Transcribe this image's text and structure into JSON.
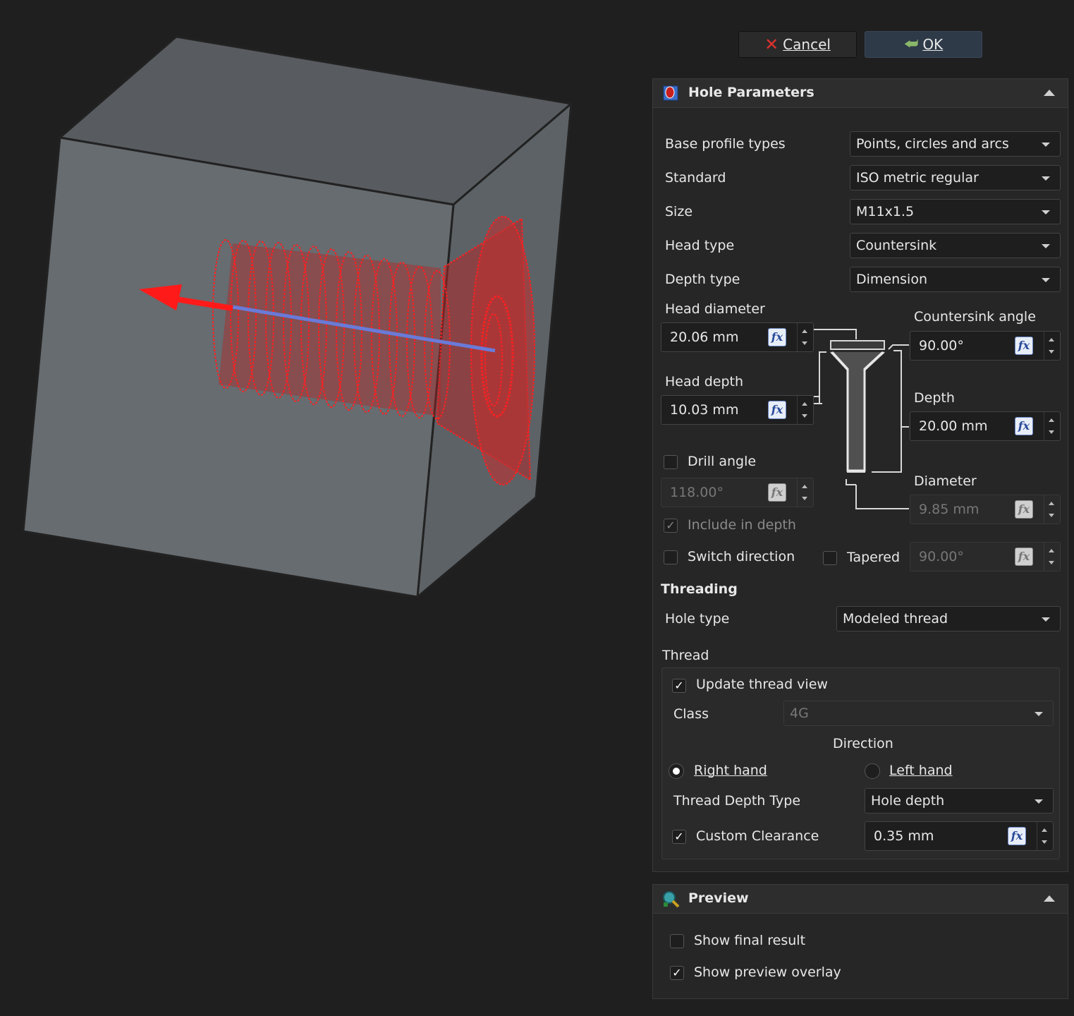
{
  "buttons": {
    "cancel": "Cancel",
    "ok": "OK"
  },
  "hole_panel": {
    "title": "Hole Parameters",
    "base_profile_types": {
      "label": "Base profile types",
      "value": "Points, circles and arcs"
    },
    "standard": {
      "label": "Standard",
      "value": "ISO metric regular"
    },
    "size": {
      "label": "Size",
      "value": "M11x1.5"
    },
    "head_type": {
      "label": "Head type",
      "value": "Countersink"
    },
    "depth_type": {
      "label": "Depth type",
      "value": "Dimension"
    },
    "head_diameter": {
      "label": "Head diameter",
      "value": "20.06 mm"
    },
    "countersink_angle": {
      "label": "Countersink angle",
      "value": "90.00°"
    },
    "head_depth": {
      "label": "Head depth",
      "value": "10.03 mm"
    },
    "depth": {
      "label": "Depth",
      "value": "20.00 mm"
    },
    "drill_angle": {
      "label": "Drill angle",
      "value": "118.00°",
      "checked": false
    },
    "diameter": {
      "label": "Diameter",
      "value": "9.85 mm"
    },
    "include_in_depth": {
      "label": "Include in depth",
      "checked": true
    },
    "switch_direction": {
      "label": "Switch direction",
      "checked": false
    },
    "tapered": {
      "label": "Tapered",
      "value": "90.00°",
      "checked": false
    },
    "threading": {
      "title": "Threading",
      "hole_type": {
        "label": "Hole type",
        "value": "Modeled thread"
      },
      "thread_group": "Thread",
      "update_thread_view": {
        "label": "Update thread view",
        "checked": true
      },
      "class": {
        "label": "Class",
        "value": "4G"
      },
      "direction": {
        "label": "Direction",
        "right_hand": "Right hand",
        "left_hand": "Left hand",
        "selected": "right"
      },
      "thread_depth_type": {
        "label": "Thread Depth Type",
        "value": "Hole depth"
      },
      "custom_clearance": {
        "label": "Custom Clearance",
        "value": "0.35 mm",
        "checked": true
      }
    }
  },
  "preview_panel": {
    "title": "Preview",
    "show_final_result": {
      "label": "Show final result",
      "checked": false
    },
    "show_preview_overlay": {
      "label": "Show preview overlay",
      "checked": true
    }
  },
  "colors": {
    "accent_red": "#ff2020",
    "face_front": "#676c70",
    "face_top": "#585c60",
    "face_side": "#5d6266",
    "background": "#1f1f1f"
  },
  "icons": {
    "cancel": "red-x-icon",
    "ok": "green-arrow-icon",
    "hole": "hole-feature-icon",
    "preview": "preview-icon",
    "expression": "fx-icon"
  }
}
